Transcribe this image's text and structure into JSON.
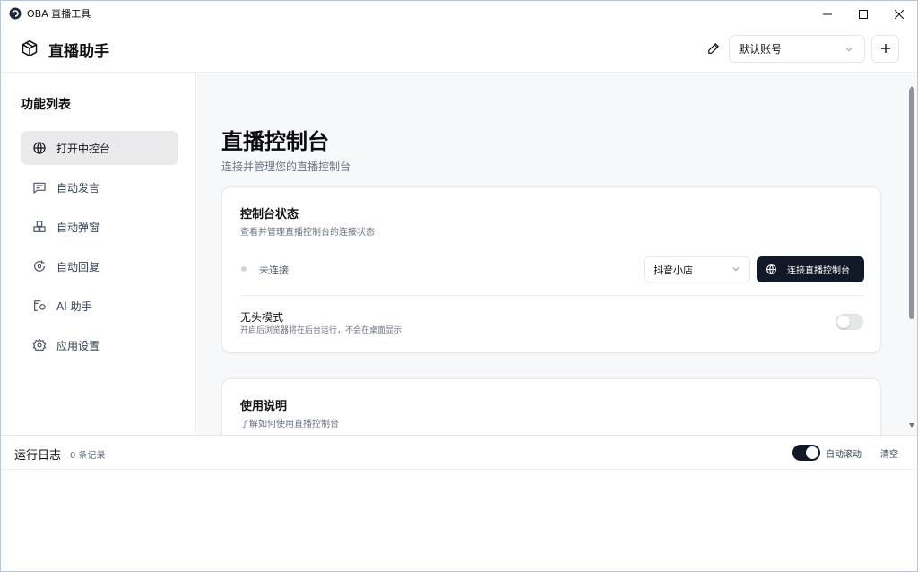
{
  "window": {
    "title": "OBA 直播工具",
    "controls": {
      "minimize": "minimize-icon",
      "maximize": "maximize-icon",
      "close": "close-icon"
    }
  },
  "header": {
    "brand_icon": "box-icon",
    "brand_title": "直播助手",
    "edit_icon": "pencil-icon",
    "account_select": {
      "value": "默认账号"
    },
    "add_icon": "plus-icon"
  },
  "sidebar": {
    "title": "功能列表",
    "items": [
      {
        "label": "打开中控台",
        "icon": "globe-icon",
        "active": true
      },
      {
        "label": "自动发言",
        "icon": "message-icon",
        "active": false
      },
      {
        "label": "自动弹窗",
        "icon": "package-icon",
        "active": false
      },
      {
        "label": "自动回复",
        "icon": "refresh-message-icon",
        "active": false
      },
      {
        "label": "AI 助手",
        "icon": "ai-assistant-icon",
        "active": false
      },
      {
        "label": "应用设置",
        "icon": "gear-icon",
        "active": false
      }
    ]
  },
  "main": {
    "title": "直播控制台",
    "subtitle": "连接并管理您的直播控制台",
    "status_card": {
      "title": "控制台状态",
      "subtitle": "查看并管理直播控制台的连接状态",
      "status_text": "未连接",
      "platform_select": {
        "value": "抖音小店"
      },
      "connect_button": "连接直播控制台",
      "headless": {
        "title": "无头模式",
        "subtitle": "开启后浏览器将在后台运行，不会在桌面显示",
        "enabled": false
      }
    },
    "usage_card": {
      "title": "使用说明",
      "subtitle": "了解如何使用直播控制台"
    }
  },
  "log": {
    "title": "运行日志",
    "count": "0 条记录",
    "auto_scroll_label": "自动滚动",
    "auto_scroll_enabled": true,
    "clear_label": "清空"
  },
  "colors": {
    "accent_dark": "#111827",
    "main_bg": "#f7f8f9",
    "active_nav_bg": "#eaeaec"
  }
}
